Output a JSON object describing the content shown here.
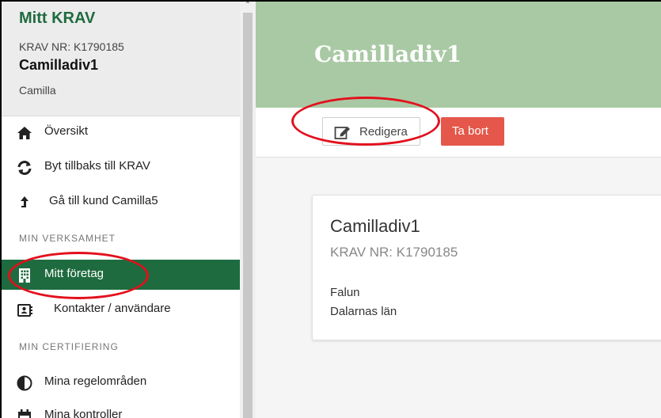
{
  "sidebar": {
    "app_title": "Mitt KRAV",
    "krav_nr": "KRAV NR: K1790185",
    "org_name": "Camilladiv1",
    "user_name": "Camilla",
    "items": [
      {
        "label": "Översikt",
        "icon": "home-icon"
      },
      {
        "label": "Byt tillbaks till KRAV",
        "icon": "refresh-icon"
      },
      {
        "label": "Gå till kund Camilla5",
        "icon": "arrow-up-icon"
      }
    ],
    "section_business": "MIN VERKSAMHET",
    "business_items": [
      {
        "label": "Mitt företag",
        "icon": "building-icon",
        "active": true
      },
      {
        "label": "Kontakter / användare",
        "icon": "contact-card-icon"
      }
    ],
    "section_cert": "MIN CERTIFIERING",
    "cert_items": [
      {
        "label": "Mina regelområden",
        "icon": "half-circle-icon"
      },
      {
        "label": "Mina kontroller",
        "icon": "calendar-icon"
      }
    ]
  },
  "header": {
    "title": "Camilladiv1"
  },
  "toolbar": {
    "edit_label": "Redigera",
    "delete_label": "Ta bort"
  },
  "card": {
    "name": "Camilladiv1",
    "krav_nr": "KRAV NR: K1790185",
    "city": "Falun",
    "region": "Dalarnas län"
  },
  "colors": {
    "brand_green": "#1e6b3f",
    "banner_green": "#a9c9a4",
    "delete_red": "#e4574a",
    "annotation_red": "#e3101d"
  }
}
